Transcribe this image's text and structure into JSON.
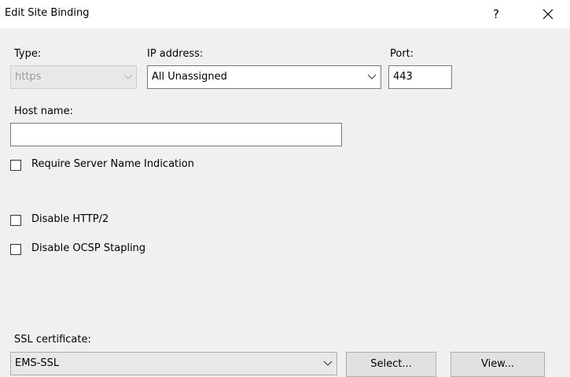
{
  "window": {
    "title": "Edit Site Binding",
    "help_label": "?",
    "close_icon": "close-icon"
  },
  "form": {
    "type_label": "Type:",
    "type_value": "https",
    "ip_label": "IP address:",
    "ip_value": "All Unassigned",
    "port_label": "Port:",
    "port_value": "443",
    "host_label": "Host name:",
    "host_value": "",
    "sni_label": "Require Server Name Indication",
    "sni_checked": false,
    "disable_http2_label": "Disable HTTP/2",
    "disable_http2_checked": false,
    "disable_ocsp_label": "Disable OCSP Stapling",
    "disable_ocsp_checked": false,
    "ssl_label": "SSL certificate:",
    "ssl_value": "EMS-SSL",
    "select_button": "Select...",
    "view_button": "View..."
  }
}
